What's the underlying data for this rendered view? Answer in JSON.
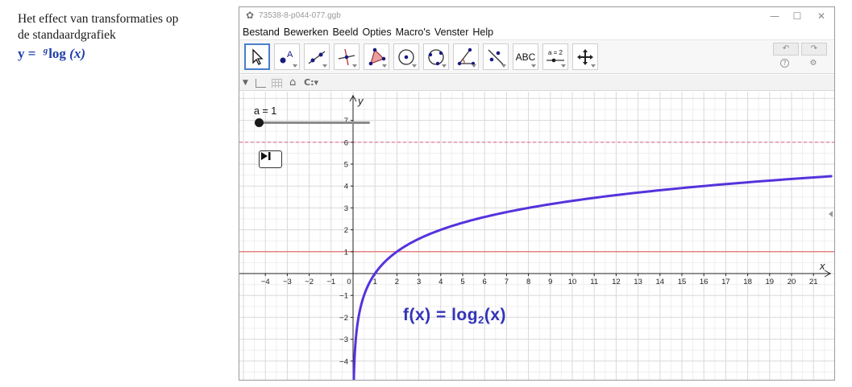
{
  "slide": {
    "title_line1": "Het effect van transformaties op",
    "title_line2": "de standaardgrafiek",
    "formula_prefix": "y = ",
    "formula_base": "g",
    "formula_fn": "log",
    "formula_arg": "(x)"
  },
  "window": {
    "title": "73538-8-p044-077.ggb",
    "minimize": "—",
    "maximize": "☐",
    "close": "✕"
  },
  "menu": [
    "Bestand",
    "Bewerken",
    "Beeld",
    "Opties",
    "Macro's",
    "Venster",
    "Help"
  ],
  "toolbar": {
    "tools": [
      {
        "name": "move-tool"
      },
      {
        "name": "point-tool"
      },
      {
        "name": "line-tool"
      },
      {
        "name": "perpendicular-line-tool"
      },
      {
        "name": "polygon-tool"
      },
      {
        "name": "circle-tool"
      },
      {
        "name": "conic-tool"
      },
      {
        "name": "angle-tool"
      },
      {
        "name": "reflect-tool"
      },
      {
        "name": "text-tool",
        "label": "ABC"
      },
      {
        "name": "slider-tool",
        "label": "a = 2"
      },
      {
        "name": "move-view-tool"
      }
    ],
    "undo": "↶",
    "redo": "↷",
    "help": "?",
    "settings": "⚙"
  },
  "stylebar": {
    "toggle": "▼",
    "home": "⌂",
    "point_capture": "C:▾"
  },
  "graphics": {
    "slider_label": "a = 1",
    "slider_value": 1,
    "function_label": "f(x)  =  log",
    "function_base": "2",
    "function_arg": "(x)",
    "x_axis_label": "x",
    "y_axis_label": "y",
    "line_color": "#5533dd",
    "hline_solid_color": "#e06060",
    "hline_dashed_color": "#e07090"
  },
  "chart_data": {
    "type": "line",
    "xlabel": "x",
    "ylabel": "y",
    "xlim": [
      -5,
      22
    ],
    "ylim": [
      -5,
      8
    ],
    "x_ticks": [
      -4,
      -3,
      -2,
      -1,
      0,
      1,
      2,
      3,
      4,
      5,
      6,
      7,
      8,
      9,
      10,
      11,
      12,
      13,
      14,
      15,
      16,
      17,
      18,
      19,
      20,
      21
    ],
    "y_ticks": [
      -4,
      -3,
      -2,
      -1,
      1,
      2,
      3,
      4,
      5,
      6,
      7
    ],
    "grid": true,
    "series": [
      {
        "name": "f(x) = log2(x)",
        "function": "log2",
        "base": 2,
        "x_from": 0.05,
        "x_to": 22
      }
    ],
    "horizontal_lines": [
      {
        "y": 1,
        "style": "solid"
      },
      {
        "y": 6,
        "style": "dashed"
      }
    ]
  }
}
